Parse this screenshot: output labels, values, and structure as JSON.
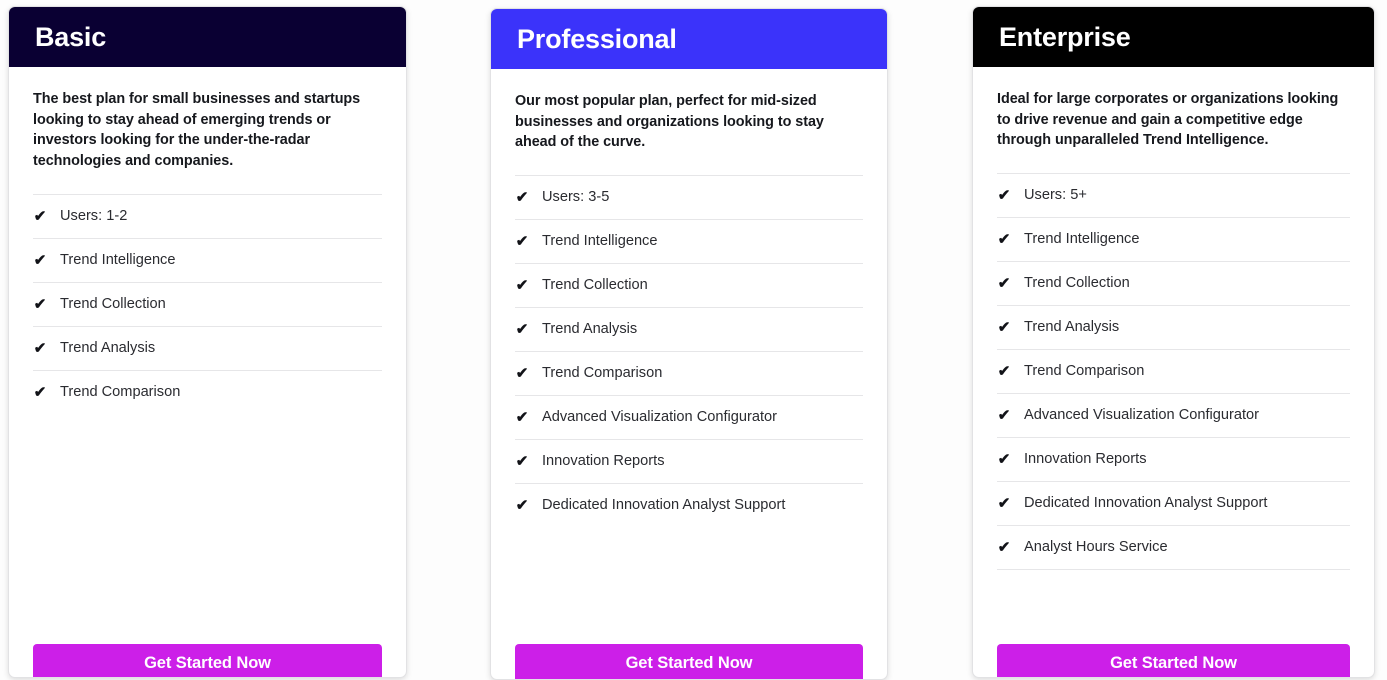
{
  "theme": {
    "page_background": "#fdfdfd",
    "cta_color": "#cc1fe8",
    "cta_text_color": "#ffffff",
    "divider_color": "#e6e6e8"
  },
  "plans": [
    {
      "name": "Basic",
      "header_color": "#0a0033",
      "description": "The best plan for small businesses and startups looking to stay ahead of emerging trends or investors looking for the under-the-radar technologies and companies.",
      "features": [
        {
          "check": "✔",
          "label": "Users: 1-2"
        },
        {
          "check": "✔",
          "label": "Trend Intelligence"
        },
        {
          "check": "✔",
          "label": "Trend Collection"
        },
        {
          "check": "✔",
          "label": "Trend Analysis"
        },
        {
          "check": "✔",
          "label": "Trend Comparison"
        }
      ],
      "cta_label": "Get Started Now"
    },
    {
      "name": "Professional",
      "header_color": "#3b33fa",
      "description": "Our most popular plan, perfect for mid-sized businesses and organizations looking to stay ahead of the curve.",
      "features": [
        {
          "check": "✔",
          "label": "Users: 3-5"
        },
        {
          "check": "✔",
          "label": "Trend Intelligence"
        },
        {
          "check": "✔",
          "label": "Trend Collection"
        },
        {
          "check": "✔",
          "label": "Trend Analysis"
        },
        {
          "check": "✔",
          "label": "Trend Comparison"
        },
        {
          "check": "✔",
          "label": "Advanced Visualization Configurator"
        },
        {
          "check": "✔",
          "label": "Innovation Reports"
        },
        {
          "check": "✔",
          "label": "Dedicated Innovation Analyst Support"
        }
      ],
      "cta_label": "Get Started Now"
    },
    {
      "name": "Enterprise",
      "header_color": "#000000",
      "description": "Ideal for large corporates or organizations looking to drive revenue and gain a competitive edge through unparalleled Trend Intelligence.",
      "features": [
        {
          "check": "✔",
          "label": "Users: 5+"
        },
        {
          "check": "✔",
          "label": "Trend Intelligence"
        },
        {
          "check": "✔",
          "label": "Trend Collection"
        },
        {
          "check": "✔",
          "label": "Trend Analysis"
        },
        {
          "check": "✔",
          "label": "Trend Comparison"
        },
        {
          "check": "✔",
          "label": "Advanced Visualization Configurator"
        },
        {
          "check": "✔",
          "label": "Innovation Reports"
        },
        {
          "check": "✔",
          "label": "Dedicated Innovation Analyst Support"
        },
        {
          "check": "✔",
          "label": "Analyst Hours Service"
        }
      ],
      "cta_label": "Get Started Now"
    }
  ]
}
